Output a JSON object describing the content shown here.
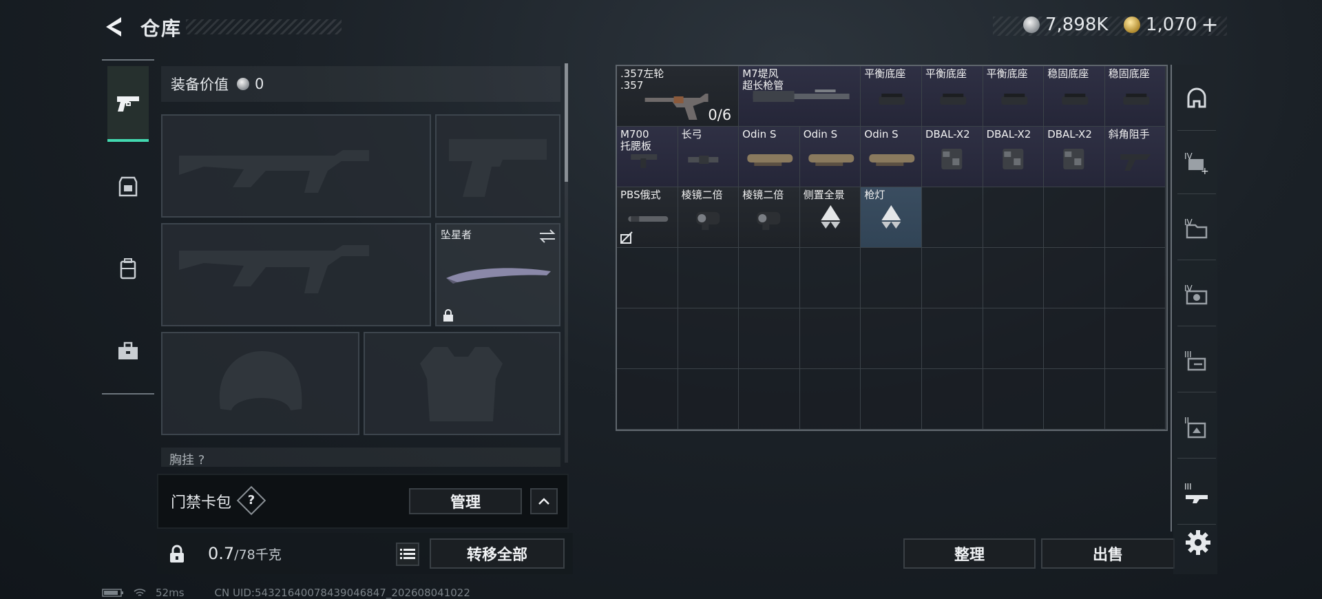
{
  "header": {
    "title": "仓库",
    "currency_silver": "7,898K",
    "currency_gold": "1,070",
    "add_label": "+"
  },
  "left_tabs": [
    {
      "name": "pistol",
      "active": true
    },
    {
      "name": "armor",
      "active": false
    },
    {
      "name": "backpack",
      "active": false
    },
    {
      "name": "toolbox",
      "active": false
    }
  ],
  "equipment": {
    "value_label": "装备价值",
    "value": "0",
    "melee_name": "坠星者",
    "chest_rig_label": "胸挂",
    "chest_rig_hint": "?"
  },
  "keycard": {
    "label": "门禁卡包",
    "help": "?",
    "manage_label": "管理"
  },
  "weight": {
    "current": "0.7",
    "max": "/78千克"
  },
  "actions": {
    "transfer_all": "转移全部",
    "sort": "整理",
    "sell": "出售"
  },
  "storage": {
    "columns": 9,
    "rows": 6,
    "items": [
      {
        "row": 0,
        "col": 0,
        "w": 2,
        "name": ".357左轮\n.357",
        "count": "0/6",
        "icon": "revolver-icon",
        "style": "dark"
      },
      {
        "row": 0,
        "col": 2,
        "w": 2,
        "name": "M7堤风\n超长枪管",
        "icon": "barrel-icon",
        "style": ""
      },
      {
        "row": 0,
        "col": 4,
        "name": "平衡底座",
        "icon": "mount-icon",
        "style": ""
      },
      {
        "row": 0,
        "col": 5,
        "name": "平衡底座",
        "icon": "mount-icon",
        "style": ""
      },
      {
        "row": 0,
        "col": 6,
        "name": "平衡底座",
        "icon": "mount-icon",
        "style": ""
      },
      {
        "row": 0,
        "col": 7,
        "name": "稳固底座",
        "icon": "mount-icon",
        "style": ""
      },
      {
        "row": 0,
        "col": 8,
        "name": "稳固底座",
        "icon": "mount-icon",
        "style": ""
      },
      {
        "row": 1,
        "col": 0,
        "name": "M700\n托腮板",
        "icon": "cheekpad-icon",
        "style": ""
      },
      {
        "row": 1,
        "col": 1,
        "name": "长弓",
        "icon": "stock-icon",
        "style": ""
      },
      {
        "row": 1,
        "col": 2,
        "name": "Odin S",
        "icon": "scope-rail-icon",
        "style": ""
      },
      {
        "row": 1,
        "col": 3,
        "name": "Odin S",
        "icon": "scope-rail-icon",
        "style": ""
      },
      {
        "row": 1,
        "col": 4,
        "name": "Odin S",
        "icon": "scope-rail-icon",
        "style": ""
      },
      {
        "row": 1,
        "col": 5,
        "name": "DBAL-X2",
        "icon": "laser-icon",
        "style": ""
      },
      {
        "row": 1,
        "col": 6,
        "name": "DBAL-X2",
        "icon": "laser-icon",
        "style": ""
      },
      {
        "row": 1,
        "col": 7,
        "name": "DBAL-X2",
        "icon": "laser-icon",
        "style": ""
      },
      {
        "row": 1,
        "col": 8,
        "name": "斜角阻手",
        "icon": "grip-icon",
        "style": ""
      },
      {
        "row": 2,
        "col": 0,
        "name": "PBS俄式",
        "icon": "suppressor-icon",
        "style": "dark",
        "badge": true
      },
      {
        "row": 2,
        "col": 1,
        "name": "棱镜二倍",
        "icon": "prism-scope-icon",
        "style": "dark"
      },
      {
        "row": 2,
        "col": 2,
        "name": "棱镜二倍",
        "icon": "prism-scope-icon",
        "style": "dark"
      },
      {
        "row": 2,
        "col": 3,
        "name": "侧置全景",
        "icon": "triangle-icon",
        "style": "dark"
      },
      {
        "row": 2,
        "col": 4,
        "name": "枪灯",
        "icon": "triangle-icon",
        "style": "selected"
      }
    ]
  },
  "right_tabs": [
    {
      "name": "helmet-tab",
      "active": false
    },
    {
      "name": "tier-iv-add-tab",
      "active": false
    },
    {
      "name": "tier-iv-folder-tab",
      "active": false
    },
    {
      "name": "tier-iv-camera-tab",
      "active": false
    },
    {
      "name": "tier-iii-key-tab",
      "active": false
    },
    {
      "name": "tier-ii-doc-tab",
      "active": false
    },
    {
      "name": "weapon-tab",
      "active": true
    }
  ],
  "status": {
    "ping": "52ms",
    "uid": "CN UID:5432164007843904684​7_202608041022"
  }
}
